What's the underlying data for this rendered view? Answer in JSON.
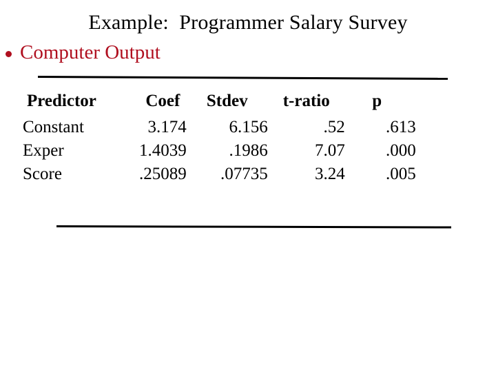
{
  "slide": {
    "title": "Example:  Programmer Salary Survey",
    "bullet": {
      "marker": "bullet-dot",
      "label": "Computer Output",
      "color": "#B01020"
    },
    "rules": {
      "top_label": "table-top-rule",
      "bottom_label": "table-bottom-rule"
    }
  },
  "table": {
    "columns": [
      "Predictor",
      "Coef",
      "Stdev",
      "t-ratio",
      "p"
    ],
    "rows": [
      {
        "predictor": "Constant",
        "coef": "3.174",
        "stdev": "6.156",
        "t_ratio": ".52",
        "p": ".613"
      },
      {
        "predictor": "Exper",
        "coef": "1.4039",
        "stdev": ".1986",
        "t_ratio": "7.07",
        "p": ".000"
      },
      {
        "predictor": "Score",
        "coef": ".25089",
        "stdev": ".07735",
        "t_ratio": "3.24",
        "p": ".005"
      }
    ]
  }
}
